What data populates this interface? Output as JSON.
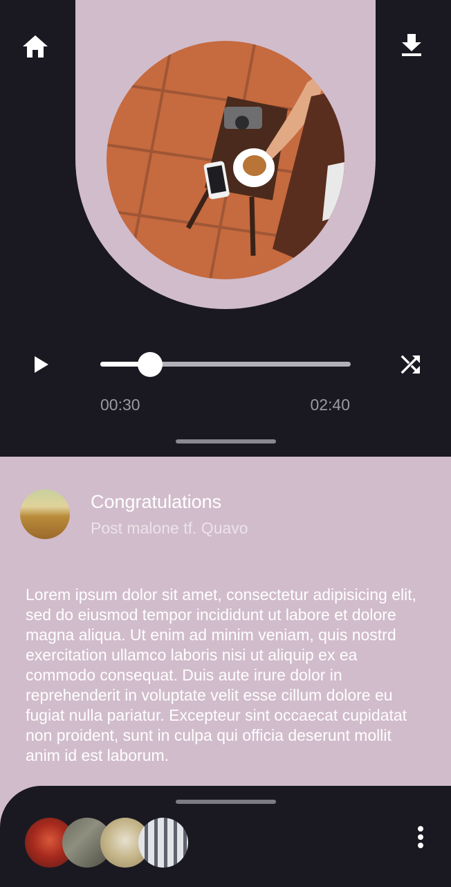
{
  "player": {
    "elapsed": "00:30",
    "total": "02:40",
    "progress": 0.2
  },
  "song": {
    "title": "Congratulations",
    "artist": "Post malone tf. Quavo",
    "description": "Lorem ipsum dolor sit amet, consectetur adipisicing elit, sed do eiusmod tempor incididunt ut labore et dolore magna aliqua. Ut enim ad minim veniam, quis nostrd exercitation ullamco laboris nisi ut aliquip ex ea commodo consequat. Duis aute irure dolor in reprehenderit in voluptate velit esse cillum dolore eu fugiat nulla pariatur. Excepteur sint occaecat cupidatat non proident, sunt in culpa qui officia deserunt mollit anim id est laborum."
  },
  "icons": {
    "home": "home-icon",
    "download": "download-icon",
    "play": "play-icon",
    "shuffle": "shuffle-icon",
    "more": "more-vert-icon"
  },
  "colors": {
    "background": "#1a1921",
    "accent": "#d1bccb",
    "text": "#ffffff",
    "muted": "#9a99a3"
  }
}
